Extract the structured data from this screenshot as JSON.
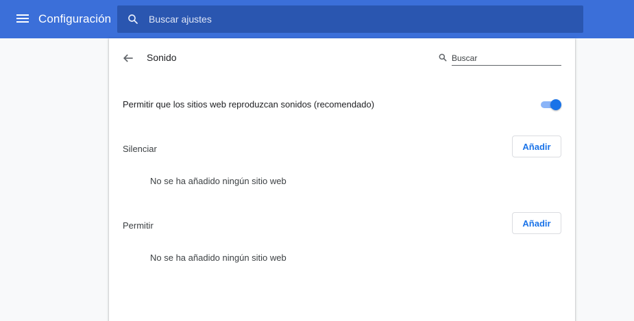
{
  "header": {
    "title": "Configuración",
    "search_placeholder": "Buscar ajustes"
  },
  "page": {
    "title": "Sonido",
    "search_placeholder": "Buscar"
  },
  "toggle_setting": {
    "label": "Permitir que los sitios web reproduzcan sonidos (recomendado)",
    "enabled": true
  },
  "sections": [
    {
      "label": "Silenciar",
      "button": "Añadir",
      "empty": "No se ha añadido ningún sitio web"
    },
    {
      "label": "Permitir",
      "button": "Añadir",
      "empty": "No se ha añadido ningún sitio web"
    }
  ],
  "colors": {
    "header_bg": "#3b6fd9",
    "accent": "#1a73e8"
  }
}
